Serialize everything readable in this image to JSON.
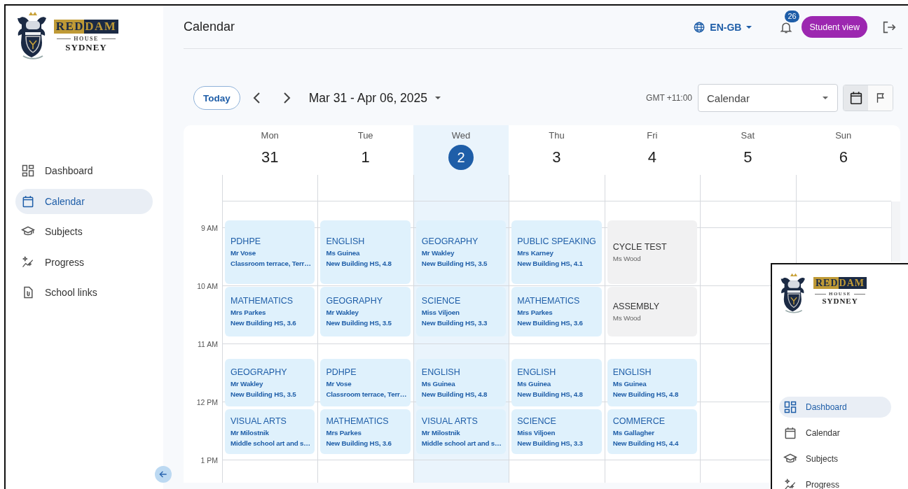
{
  "sidebar": {
    "logo": {
      "brand_part_1": "RED",
      "brand_part_2": "DAM",
      "subtitle": "HOUSE",
      "city": "SYDNEY"
    },
    "nav": [
      {
        "label": "Dashboard",
        "selected": false
      },
      {
        "label": "Calendar",
        "selected": true
      },
      {
        "label": "Subjects",
        "selected": false
      },
      {
        "label": "Progress",
        "selected": false
      },
      {
        "label": "School links",
        "selected": false
      }
    ]
  },
  "header": {
    "title": "Calendar",
    "language": "EN-GB",
    "notifications": "26",
    "role_button": "Student view"
  },
  "toolbar": {
    "today": "Today",
    "range": "Mar 31 - Apr 06, 2025",
    "timezone": "GMT +11:00",
    "view_select": "Calendar",
    "view_toggle": [
      {
        "selected": true
      },
      {
        "selected": false
      }
    ]
  },
  "calendar": {
    "hours": [
      "9 AM",
      "10 AM",
      "11 AM",
      "12 PM",
      "1 PM"
    ],
    "days": [
      {
        "name": "Mon",
        "date": "31",
        "today": false,
        "events": [
          {
            "kind": "lesson",
            "title": "PDHPE",
            "teacher": "Mr Vose",
            "location": "Classroom terrace, Terr…"
          },
          {
            "kind": "lesson",
            "title": "MATHEMATICS",
            "teacher": "Mrs Parkes",
            "location": "New Building HS, 3.6"
          },
          {
            "kind": "lesson",
            "title": "GEOGRAPHY",
            "teacher": "Mr Wakley",
            "location": "New Building HS, 3.5"
          },
          {
            "kind": "lesson",
            "title": "VISUAL ARTS",
            "teacher": "Mr Milostnik",
            "location": "Middle school art and s…"
          }
        ]
      },
      {
        "name": "Tue",
        "date": "1",
        "today": false,
        "events": [
          {
            "kind": "lesson",
            "title": "ENGLISH",
            "teacher": "Ms Guinea",
            "location": "New Building HS, 4.8"
          },
          {
            "kind": "lesson",
            "title": "GEOGRAPHY",
            "teacher": "Mr Wakley",
            "location": "New Building HS, 3.5"
          },
          {
            "kind": "lesson",
            "title": "PDHPE",
            "teacher": "Mr Vose",
            "location": "Classroom terrace, Terr…"
          },
          {
            "kind": "lesson",
            "title": "MATHEMATICS",
            "teacher": "Mrs Parkes",
            "location": "New Building HS, 3.6"
          }
        ]
      },
      {
        "name": "Wed",
        "date": "2",
        "today": true,
        "events": [
          {
            "kind": "lesson",
            "title": "GEOGRAPHY",
            "teacher": "Mr Wakley",
            "location": "New Building HS, 3.5"
          },
          {
            "kind": "lesson",
            "title": "SCIENCE",
            "teacher": "Miss Viljoen",
            "location": "New Building HS, 3.3"
          },
          {
            "kind": "lesson",
            "title": "ENGLISH",
            "teacher": "Ms Guinea",
            "location": "New Building HS, 4.8"
          },
          {
            "kind": "lesson",
            "title": "VISUAL ARTS",
            "teacher": "Mr Milostnik",
            "location": "Middle school art and s…"
          }
        ]
      },
      {
        "name": "Thu",
        "date": "3",
        "today": false,
        "events": [
          {
            "kind": "lesson",
            "title": "PUBLIC SPEAKING",
            "teacher": "Mrs Karney",
            "location": "New Building HS, 4.1"
          },
          {
            "kind": "lesson",
            "title": "MATHEMATICS",
            "teacher": "Mrs Parkes",
            "location": "New Building HS, 3.6"
          },
          {
            "kind": "lesson",
            "title": "ENGLISH",
            "teacher": "Ms Guinea",
            "location": "New Building HS, 4.8"
          },
          {
            "kind": "lesson",
            "title": "SCIENCE",
            "teacher": "Miss Viljoen",
            "location": "New Building HS, 3.3"
          }
        ]
      },
      {
        "name": "Fri",
        "date": "4",
        "today": false,
        "events": [
          {
            "kind": "event",
            "title": "CYCLE TEST",
            "teacher": "Ms Wood"
          },
          {
            "kind": "event",
            "title": "ASSEMBLY",
            "teacher": "Ms Wood"
          },
          {
            "kind": "lesson",
            "title": "ENGLISH",
            "teacher": "Ms Guinea",
            "location": "New Building HS, 4.8"
          },
          {
            "kind": "lesson",
            "title": "COMMERCE",
            "teacher": "Ms Gallagher",
            "location": "New Building HS, 4.4"
          }
        ]
      },
      {
        "name": "Sat",
        "date": "5",
        "today": false
      },
      {
        "name": "Sun",
        "date": "6",
        "today": false
      }
    ]
  },
  "inset": {
    "logo": {
      "brand_part_1": "RED",
      "brand_part_2": "DAM",
      "subtitle": "HOUSE",
      "city": "SYDNEY"
    },
    "nav": [
      {
        "label": "Dashboard",
        "selected": true
      },
      {
        "label": "Calendar",
        "selected": false
      },
      {
        "label": "Subjects",
        "selected": false
      },
      {
        "label": "Progress",
        "selected": false
      }
    ]
  }
}
